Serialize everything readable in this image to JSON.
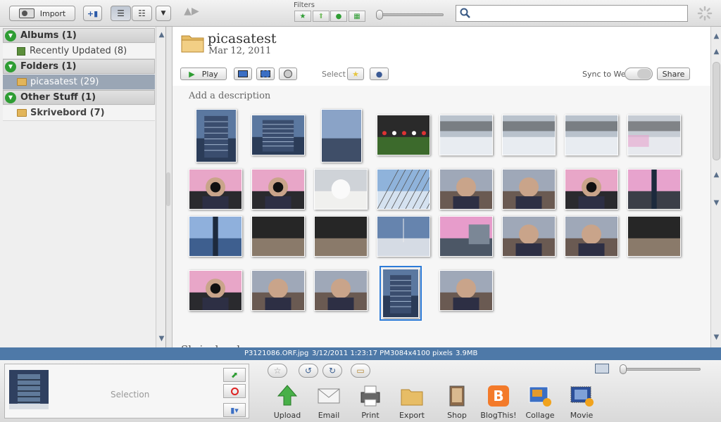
{
  "toolbar": {
    "import_label": "Import",
    "filters_label": "Filters",
    "search_placeholder": "",
    "search_value": ""
  },
  "sidebar": {
    "groups": [
      {
        "label": "Albums (1)",
        "items": [
          {
            "label": "Recently Updated (8)"
          }
        ]
      },
      {
        "label": "Folders (1)",
        "items": [
          {
            "label": "picasatest (29)"
          }
        ]
      },
      {
        "label": "Other Stuff (1)",
        "items": [
          {
            "label": "Skrivebord (7)"
          }
        ]
      }
    ]
  },
  "album": {
    "title": "picasatest",
    "date": "Mar 12, 2011",
    "play_label": "Play",
    "select_label": "Select",
    "sync_label": "Sync to Web",
    "share_label": "Share",
    "description_placeholder": "Add a description",
    "next_folder_partial": "Skrivebord"
  },
  "thumbnails": [
    {
      "kind": "tower"
    },
    {
      "kind": "tower"
    },
    {
      "kind": "structure"
    },
    {
      "kind": "soccer"
    },
    {
      "kind": "snow"
    },
    {
      "kind": "snow"
    },
    {
      "kind": "snow"
    },
    {
      "kind": "snowpink"
    },
    {
      "kind": "camera"
    },
    {
      "kind": "camera"
    },
    {
      "kind": "swan"
    },
    {
      "kind": "fence"
    },
    {
      "kind": "portrait"
    },
    {
      "kind": "portrait"
    },
    {
      "kind": "camera"
    },
    {
      "kind": "bridge"
    },
    {
      "kind": "sky"
    },
    {
      "kind": "dark"
    },
    {
      "kind": "dark"
    },
    {
      "kind": "harbor"
    },
    {
      "kind": "city"
    },
    {
      "kind": "portrait"
    },
    {
      "kind": "portrait"
    },
    {
      "kind": "dark"
    },
    {
      "kind": "camera"
    },
    {
      "kind": "portrait"
    },
    {
      "kind": "portrait"
    },
    {
      "kind": "tower"
    },
    {
      "kind": "portrait"
    }
  ],
  "selected_index": 27,
  "status": {
    "filename": "P3121086.ORF.jpg",
    "datetime": "3/12/2011 1:23:17 PM",
    "dimensions": "3084x4100 pixels",
    "size": "3.9MB"
  },
  "tray": {
    "selection_label": "Selection",
    "actions": [
      {
        "label": "Upload"
      },
      {
        "label": "Email"
      },
      {
        "label": "Print"
      },
      {
        "label": "Export"
      },
      {
        "label": "Shop"
      },
      {
        "label": "BlogThis!"
      },
      {
        "label": "Collage"
      },
      {
        "label": "Movie"
      }
    ]
  },
  "colors": {
    "accent_green": "#2e9d33",
    "status_blue": "#4e79a8",
    "selection_blue": "#2c7bd8"
  }
}
